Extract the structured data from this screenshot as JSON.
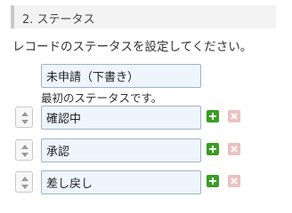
{
  "section": {
    "title": "2. ステータス"
  },
  "description": "レコードのステータスを設定してください。",
  "initial_status": {
    "value": "未申請（下書き）",
    "note": "最初のステータスです。"
  },
  "statuses": [
    {
      "value": "確認中"
    },
    {
      "value": "承認"
    },
    {
      "value": "差し戻し"
    }
  ],
  "colors": {
    "input_bg": "#eef5fc",
    "input_border": "#9fb3c8",
    "add_button": "#3a9d23",
    "remove_button_disabled": "#ecc1c1",
    "header_bg": "#f3f3f3"
  },
  "icons": {
    "sort": "sort-handle-icon",
    "add": "plus-icon",
    "remove": "close-icon"
  }
}
